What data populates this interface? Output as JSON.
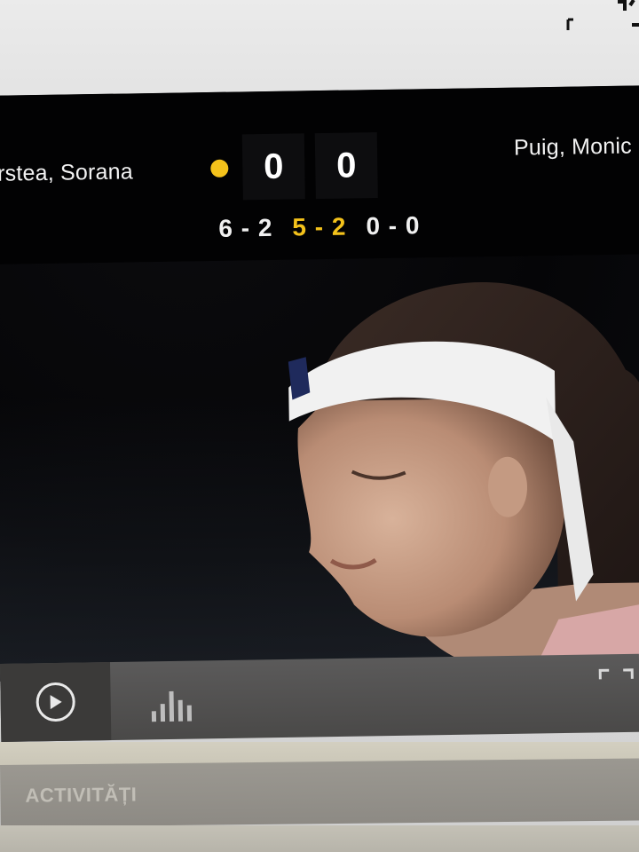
{
  "scoreboard": {
    "player_left": "irstea, Sorana",
    "player_right": "Puig, Monic",
    "points_left": "0",
    "points_right": "0",
    "sets": [
      {
        "score": "6-2",
        "current": false
      },
      {
        "score": "5-2",
        "current": true
      },
      {
        "score": "0-0",
        "current": false
      }
    ],
    "serving": "left"
  },
  "controls": {
    "play_icon": "play-icon",
    "stats_icon": "bar-chart-icon",
    "expand_icon": "fullscreen-icon"
  },
  "tabs": {
    "activity_label": "ACTIVITĂȚI"
  },
  "colors": {
    "accent": "#f4c21b",
    "scoreboard_bg": "#020203"
  }
}
